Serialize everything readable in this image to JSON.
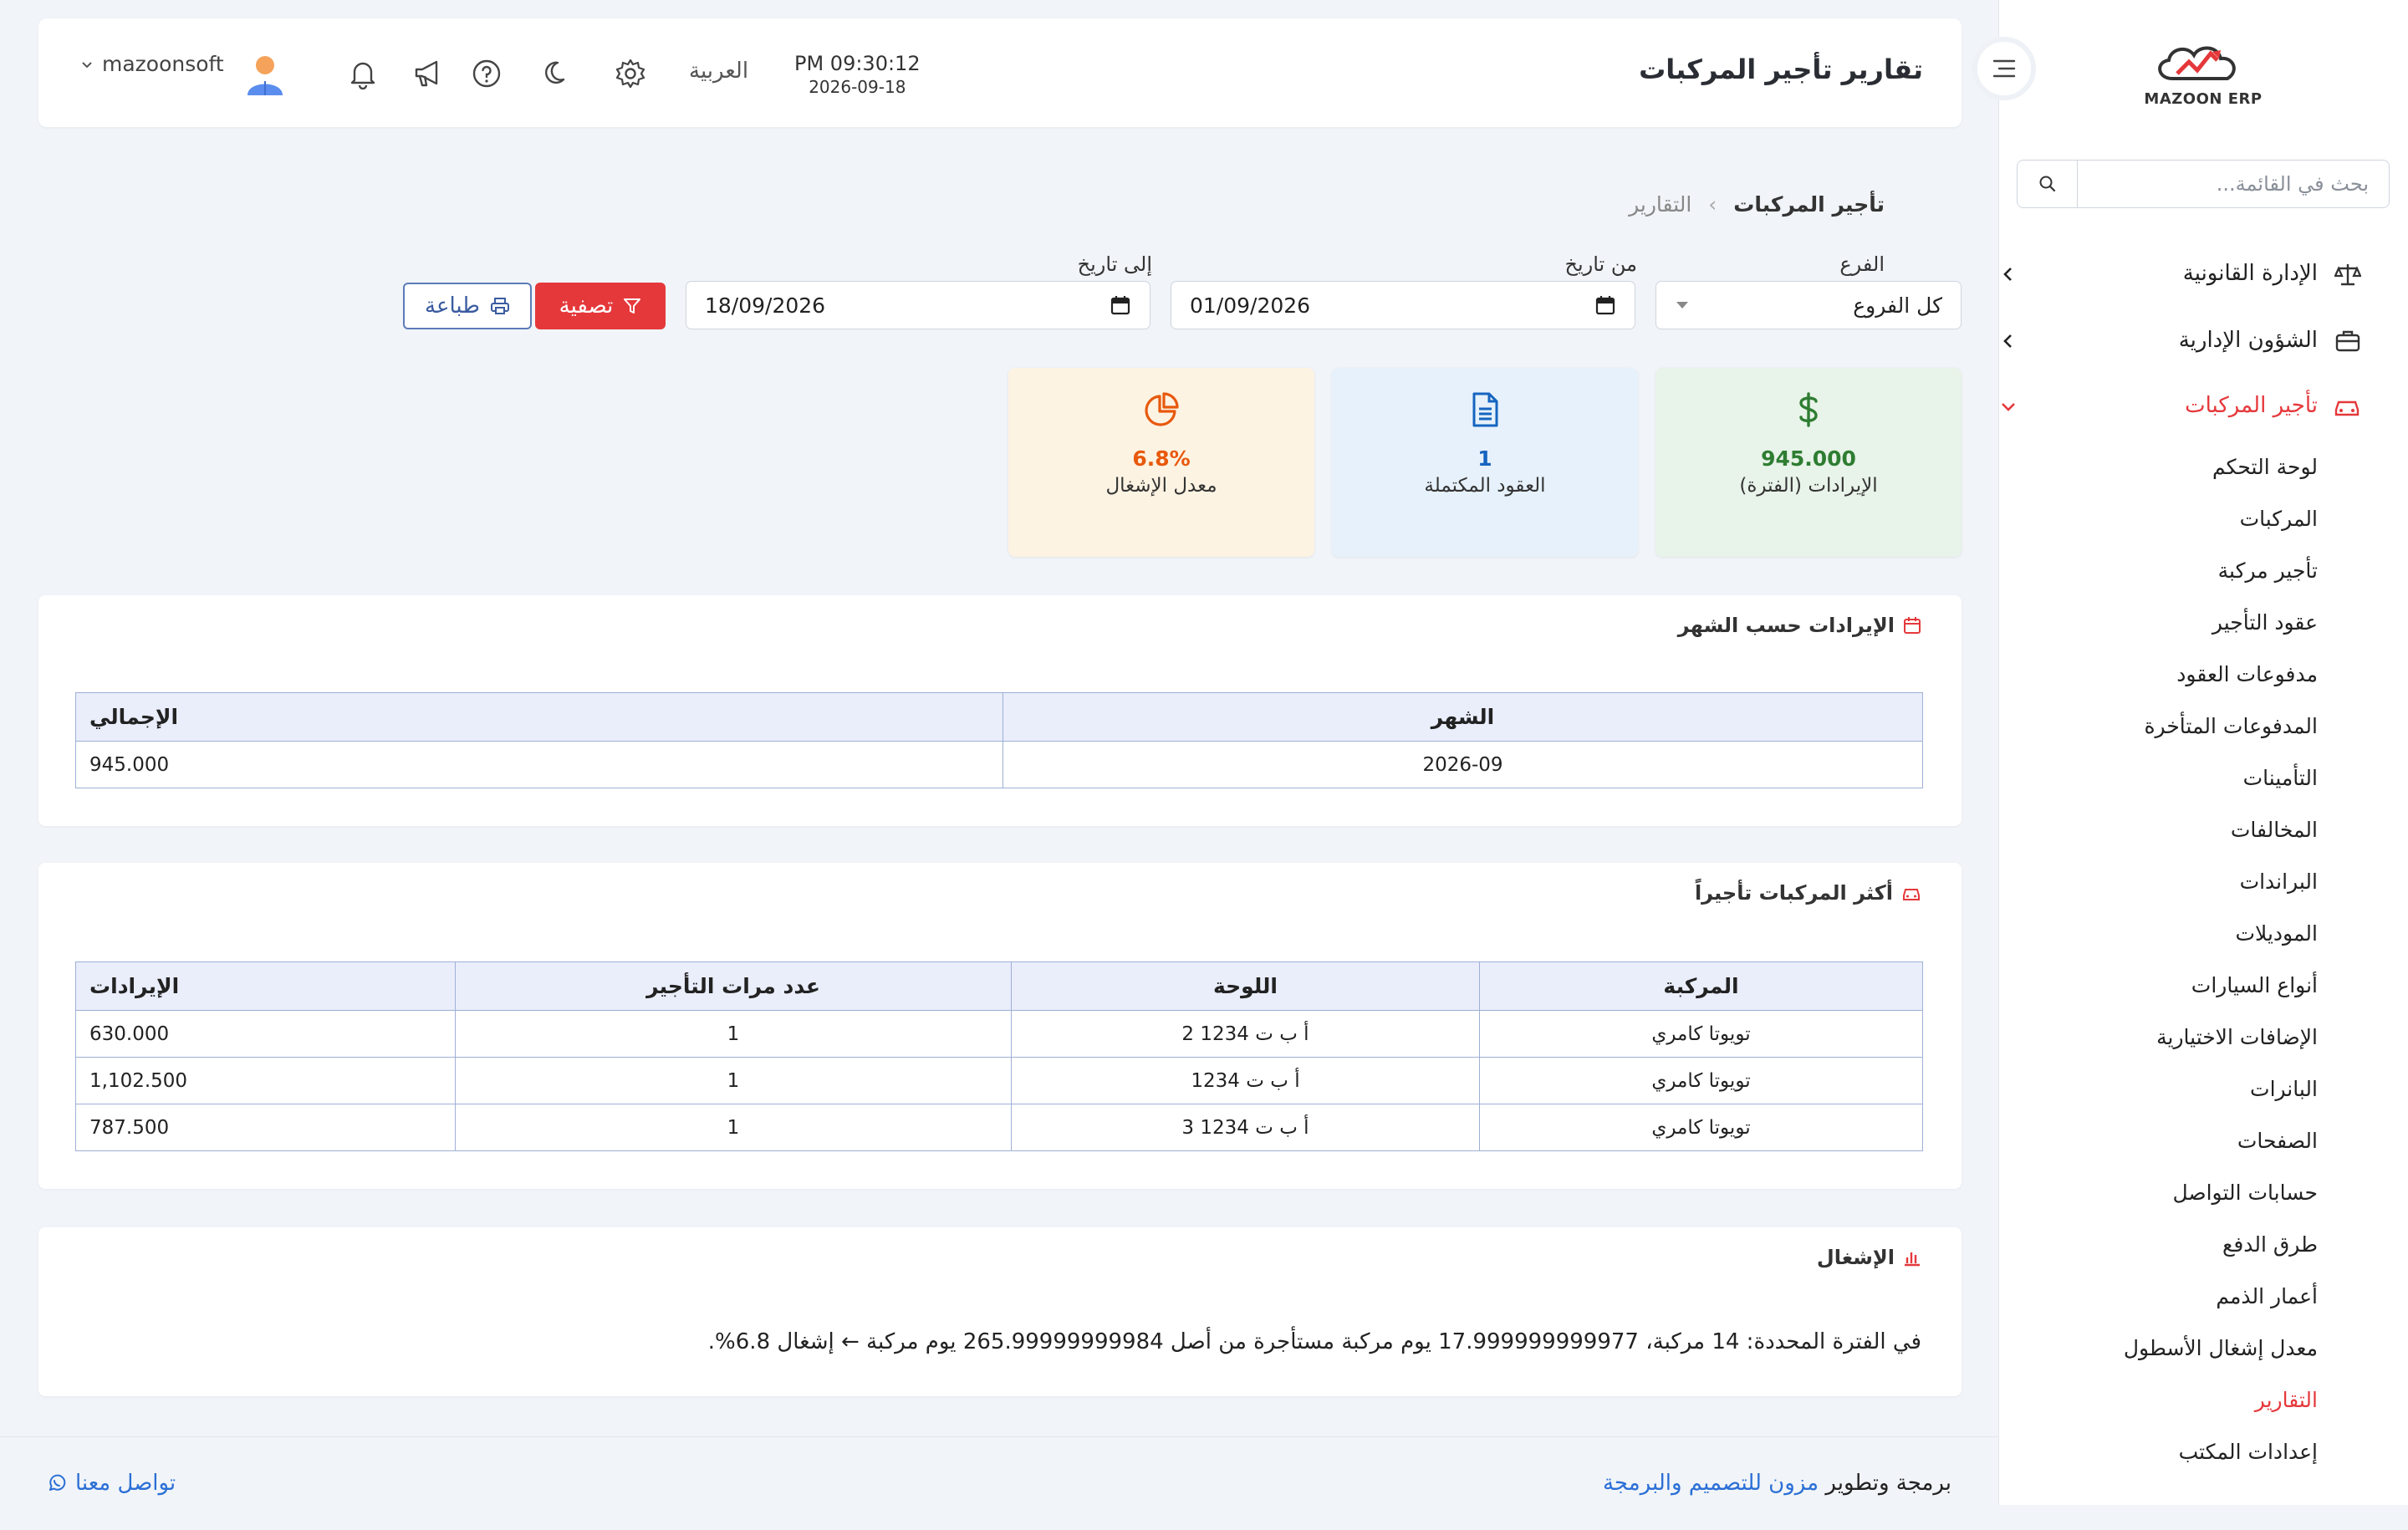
{
  "brand": {
    "logo_text": "MAZOON ERP",
    "accent": "#e5383b"
  },
  "sidebar": {
    "search_placeholder": "بحث في القائمة...",
    "groups": [
      {
        "label": "الإدارة القانونية",
        "icon": "scale-icon"
      },
      {
        "label": "الشؤون الإدارية",
        "icon": "briefcase-icon"
      },
      {
        "label": "تأجير المركبات",
        "icon": "car-icon",
        "expanded": true
      }
    ],
    "sub_items": [
      "لوحة التحكم",
      "المركبات",
      "تأجير مركبة",
      "عقود التأجير",
      "مدفوعات العقود",
      "المدفوعات المتأخرة",
      "التأمينات",
      "المخالفات",
      "البراندات",
      "الموديلات",
      "أنواع السيارات",
      "الإضافات الاختيارية",
      "البانرات",
      "الصفحات",
      "حسابات التواصل",
      "طرق الدفع",
      "أعمار الذمم",
      "معدل إشغال الأسطول",
      "التقارير",
      "إعدادات المكتب"
    ],
    "active_sub": "التقارير"
  },
  "header": {
    "title": "تقارير تأجير المركبات",
    "time": "PM 09:30:12",
    "date": "2026-09-18",
    "language": "العربية",
    "username": "mazoonsoft"
  },
  "breadcrumb": {
    "current": "تأجير المركبات",
    "parent": "التقارير"
  },
  "filters": {
    "branch_label": "الفرع",
    "branch_value": "كل الفروع",
    "from_label": "من تاريخ",
    "from_value": "01/09/2026",
    "to_label": "إلى تاريخ",
    "to_value": "18/09/2026",
    "filter_button": "تصفية",
    "print_button": "طباعة"
  },
  "stats": [
    {
      "value": "945.000",
      "label": "الإيرادات (الفترة)",
      "color": "#2e7d32",
      "bg": "#e8f3e9",
      "icon": "dollar-icon"
    },
    {
      "value": "1",
      "label": "العقود المكتملة",
      "color": "#1565c0",
      "bg": "#e6f1fb",
      "icon": "document-icon"
    },
    {
      "value": "6.8%",
      "label": "معدل الإشغال",
      "color": "#e8590c",
      "bg": "#fdf3e3",
      "icon": "pie-chart-icon"
    }
  ],
  "revenue_by_month": {
    "title": "الإيرادات حسب الشهر",
    "headers": [
      "الشهر",
      "الإجمالي"
    ],
    "rows": [
      [
        "2026-09",
        "945.000"
      ]
    ]
  },
  "top_vehicles": {
    "title": "أكثر المركبات تأجيراً",
    "headers": [
      "المركبة",
      "اللوحة",
      "عدد مرات التأجير",
      "الإيرادات"
    ],
    "rows": [
      [
        "تويوتا كامري",
        "أ ب ت 1234 2",
        "1",
        "630.000"
      ],
      [
        "تويوتا كامري",
        "أ ب ت 1234",
        "1",
        "1,102.500"
      ],
      [
        "تويوتا كامري",
        "أ ب ت 1234 3",
        "1",
        "787.500"
      ]
    ]
  },
  "occupancy": {
    "title": "الإشغال",
    "text": "في الفترة المحددة: 14 مركبة، 17.999999999977 يوم مركبة مستأجرة من أصل 265.99999999984 يوم مركبة ← إشغال 6.8%."
  },
  "footer": {
    "credit_prefix": "برمجة وتطوير",
    "credit_link": "مزون للتصميم والبرمجة",
    "contact": "تواصل معنا"
  }
}
